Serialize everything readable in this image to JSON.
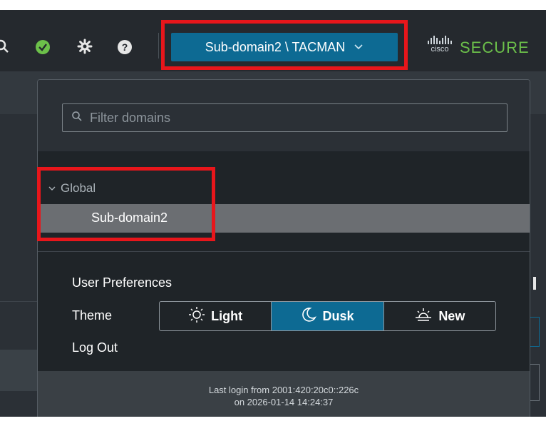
{
  "topbar": {
    "icons": [
      "search-icon",
      "check-status-icon",
      "gear-icon",
      "help-icon"
    ],
    "help_glyph": "?",
    "domain_button_label": "Sub-domain2 \\ TACMAN",
    "brand_logo": "cisco",
    "brand_product": "SECURE"
  },
  "dropdown": {
    "filter_placeholder": "Filter domains",
    "tree": {
      "root_label": "Global",
      "selected_child": "Sub-domain2"
    },
    "user_preferences_label": "User Preferences",
    "theme_label": "Theme",
    "theme_options": [
      {
        "label": "Light",
        "icon": "sun-icon",
        "active": false
      },
      {
        "label": "Dusk",
        "icon": "moon-icon",
        "active": true
      },
      {
        "label": "New",
        "icon": "sunrise-icon",
        "active": false
      }
    ],
    "logout_label": "Log Out",
    "last_login_line1": "Last login from 2001:420:20c0::226c",
    "last_login_line2": "on 2026-01-14 14:24:37"
  },
  "colors": {
    "accent": "#0d6a93",
    "highlight": "#e8161b",
    "status_green": "#6cc04a",
    "panel_bg": "#1f2428"
  }
}
